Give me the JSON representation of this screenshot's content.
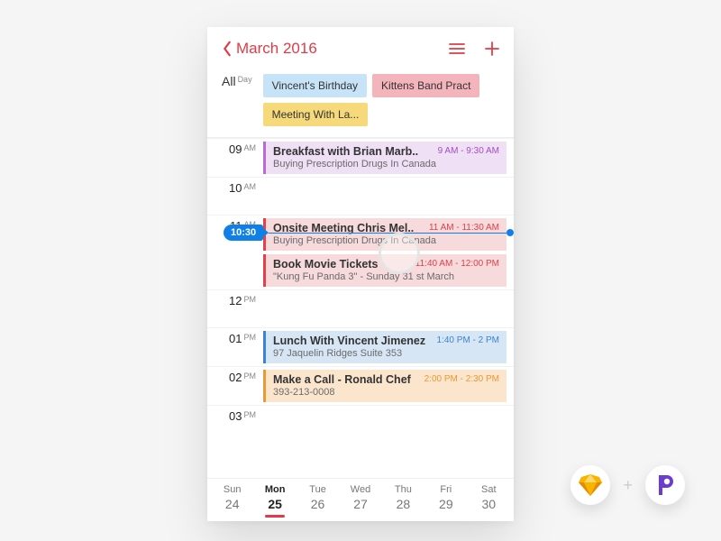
{
  "header": {
    "back_label": "March 2016"
  },
  "allday": {
    "label": "All",
    "super": "Day",
    "chips": [
      {
        "label": "Vincent's Birthday",
        "bg": "#c6e3f7",
        "fg": "#333"
      },
      {
        "label": "Kittens Band Pract",
        "bg": "#f4b4bb",
        "fg": "#333"
      },
      {
        "label": "Meeting With La...",
        "bg": "#f6d97b",
        "fg": "#333"
      }
    ]
  },
  "now": {
    "label": "10:30"
  },
  "hours": [
    {
      "num": "09",
      "suf": "AM",
      "events": [
        {
          "title": "Breakfast with Brian Marb..",
          "sub": "Buying Prescription Drugs In Canada",
          "time": "9 AM - 9:30 AM",
          "bg": "#efe0f5",
          "bar": "#b96bd4",
          "tcolor": "#a24fc5"
        }
      ]
    },
    {
      "num": "10",
      "suf": "AM",
      "events": []
    },
    {
      "num": "11",
      "suf": "AM",
      "events": [
        {
          "title": "Onsite Meeting Chris Mel..",
          "sub": "Buying Prescription Drugs In Canada",
          "time": "11 AM - 11:30 AM",
          "bg": "#f7dadb",
          "bar": "#e3404a",
          "tcolor": "#e3404a"
        },
        {
          "title": "Book Movie Tickets",
          "sub": "\"Kung Fu Panda 3\" - Sunday 31 st March",
          "time": "11:40 AM - 12:00 PM",
          "bg": "#f7dadb",
          "bar": "#e3404a",
          "tcolor": "#e3404a"
        }
      ]
    },
    {
      "num": "12",
      "suf": "PM",
      "events": []
    },
    {
      "num": "01",
      "suf": "PM",
      "events": [
        {
          "title": "Lunch With Vincent Jimenez",
          "sub": "97 Jaquelin Ridges Suite 353",
          "time": "1:40 PM - 2 PM",
          "bg": "#d7e6f5",
          "bar": "#3a84d6",
          "tcolor": "#3a84d6"
        }
      ]
    },
    {
      "num": "02",
      "suf": "PM",
      "events": [
        {
          "title": "Make a Call - Ronald Chef",
          "sub": "393-213-0008",
          "time": "2:00 PM - 2:30 PM",
          "bg": "#fbe6cd",
          "bar": "#e89a34",
          "tcolor": "#e89a34"
        }
      ]
    },
    {
      "num": "03",
      "suf": "PM",
      "events": []
    }
  ],
  "week": [
    {
      "name": "Sun",
      "num": "24",
      "active": false
    },
    {
      "name": "Mon",
      "num": "25",
      "active": true
    },
    {
      "name": "Tue",
      "num": "26",
      "active": false
    },
    {
      "name": "Wed",
      "num": "27",
      "active": false
    },
    {
      "name": "Thu",
      "num": "28",
      "active": false
    },
    {
      "name": "Fri",
      "num": "29",
      "active": false
    },
    {
      "name": "Sat",
      "num": "30",
      "active": false
    }
  ],
  "footer": {
    "sep": "+"
  }
}
